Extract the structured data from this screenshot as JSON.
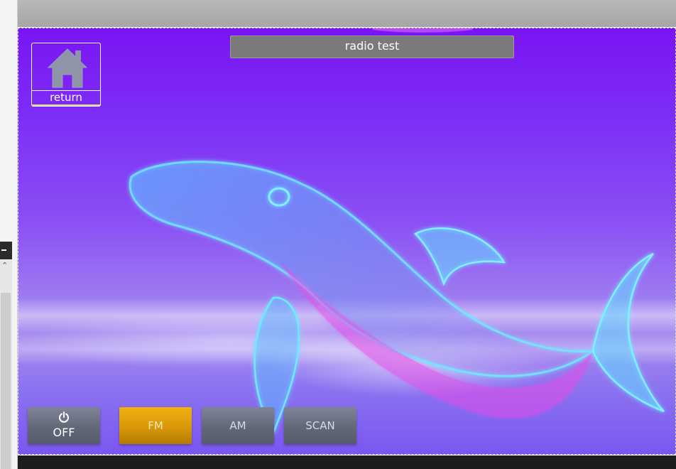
{
  "screen": {
    "title": "radio test"
  },
  "return_button": {
    "label": "return",
    "icon": "home-icon"
  },
  "controls": {
    "off": {
      "label": "OFF",
      "icon": "power-icon"
    },
    "fm": {
      "label": "FM",
      "state": "selected"
    },
    "am": {
      "label": "AM"
    },
    "scan": {
      "label": "SCAN"
    }
  },
  "colors": {
    "background_top": "#7a14f3",
    "selected_button": "#e0a00a",
    "button_gray": "#626878",
    "title_bar": "#7a7a7a"
  }
}
